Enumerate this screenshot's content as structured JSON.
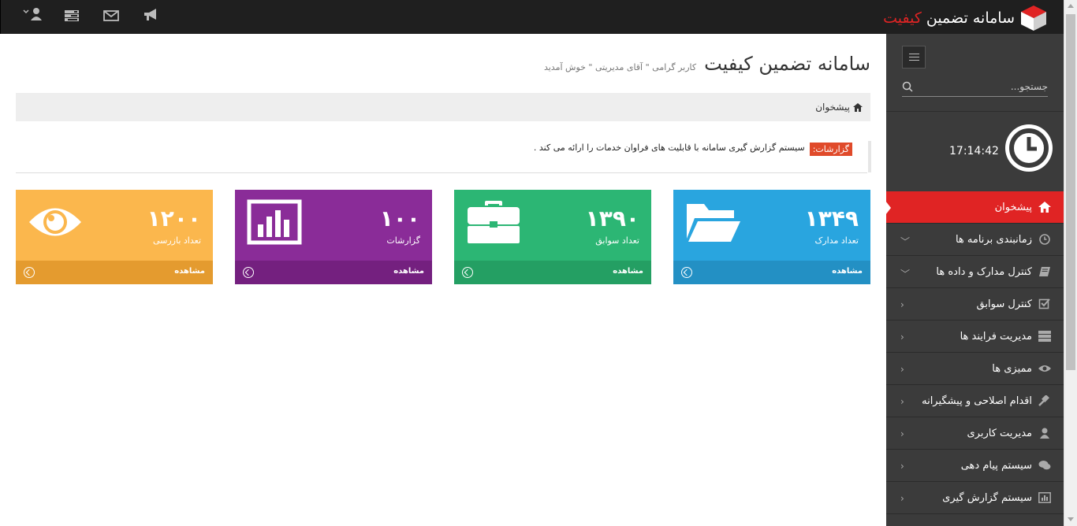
{
  "topbar": {
    "brand_white": "سامانه تضمین",
    "brand_red": "کیفیت",
    "icons": [
      "user-icon",
      "tasks-icon",
      "mail-icon",
      "megaphone-icon"
    ]
  },
  "header": {
    "title": "سامانه تضمین کیفیت",
    "welcome": "کاربر گرامی \" آقای مدیریتی \" خوش آمدید"
  },
  "breadcrumb": {
    "home_label": "پیشخوان"
  },
  "notice": {
    "tag": "گزارشات:",
    "text": "سیستم گزارش گیری سامانه با قابلیت های فراوان خدمات را ارائه می کند ."
  },
  "cards": [
    {
      "number": "۱۳۴۹",
      "label": "تعداد مدارک",
      "footer": "مشاهده",
      "color": "#29a5df",
      "footer_color": "#2390c4",
      "icon": "folder-open-icon"
    },
    {
      "number": "۱۳۹۰",
      "label": "تعداد سوابق",
      "footer": "مشاهده",
      "color": "#2cb674",
      "footer_color": "#249f63",
      "icon": "briefcase-icon"
    },
    {
      "number": "۱۰۰",
      "label": "گزارشات",
      "footer": "مشاهده",
      "color": "#8a2c98",
      "footer_color": "#74207f",
      "icon": "bar-chart-icon"
    },
    {
      "number": "۱۲۰۰",
      "label": "تعداد بازرسی",
      "footer": "مشاهده",
      "color": "#fbb74d",
      "footer_color": "#e49b2f",
      "icon": "eye-icon"
    }
  ],
  "sidebar": {
    "search_placeholder": "جستجو...",
    "time": "17:14:42",
    "items": [
      {
        "label": "پیشخوان",
        "icon": "home-icon",
        "active": true
      },
      {
        "label": "زمانبندی برنامه ها",
        "icon": "clock-icon",
        "chevron": "down"
      },
      {
        "label": "کنترل مدارک و داده ها",
        "icon": "book-icon",
        "chevron": "down"
      },
      {
        "label": "کنترل سوابق",
        "icon": "checkbox-icon",
        "chevron": "left"
      },
      {
        "label": "مدیریت فرایند ها",
        "icon": "tasks-icon",
        "chevron": "left"
      },
      {
        "label": "ممیزی ها",
        "icon": "eye-icon",
        "chevron": "left"
      },
      {
        "label": "اقدام اصلاحی و پیشگیرانه",
        "icon": "gavel-icon",
        "chevron": "left"
      },
      {
        "label": "مدیریت کاربری",
        "icon": "user-icon",
        "chevron": "left"
      },
      {
        "label": "سیستم پیام دهی",
        "icon": "comments-icon",
        "chevron": "left"
      },
      {
        "label": "سیستم گزارش گیری",
        "icon": "bar-chart-icon",
        "chevron": "left"
      }
    ]
  },
  "colors": {
    "accent": "#e02424",
    "topbar": "#1f1f1f",
    "sidebar": "#3b3b3b"
  }
}
